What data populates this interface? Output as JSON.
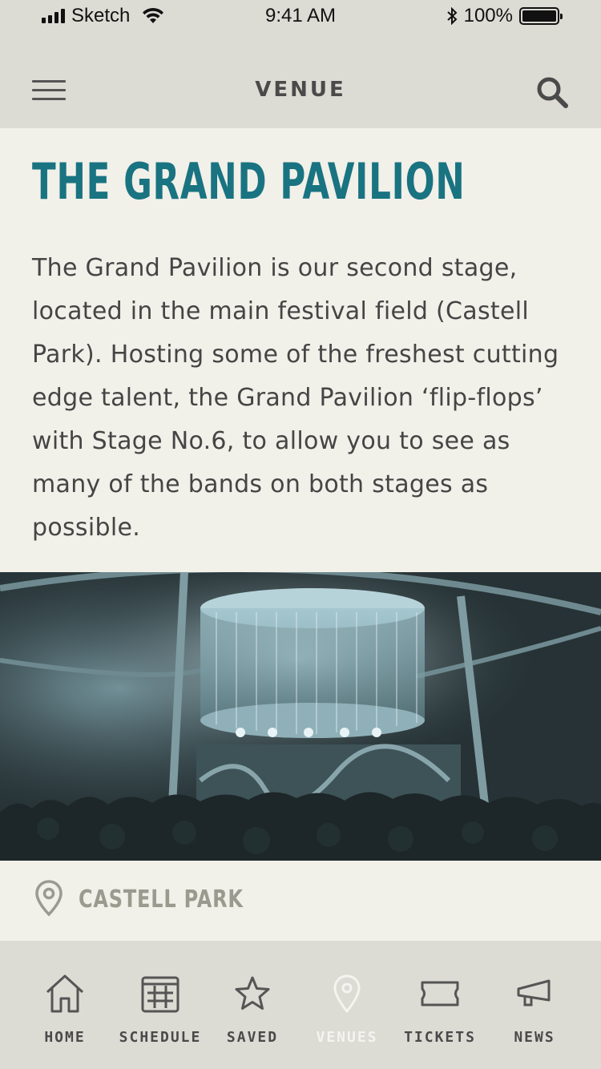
{
  "status_bar": {
    "carrier": "Sketch",
    "time": "9:41 AM",
    "battery": "100%"
  },
  "header": {
    "title": "VENUE",
    "menu_icon": "hamburger-menu-icon",
    "search_icon": "search-icon"
  },
  "venue": {
    "name": "THE GRAND PAVILION",
    "description": "The Grand Pavilion is our second stage, located in the main festival field (Castell Park). Hosting some of the freshest cutting edge talent, the Grand Pavilion ‘flip-flops’ with Stage No.6, to allow you to see as many of the bands on both stages as possible.",
    "location": "CASTELL PARK"
  },
  "tabs": [
    {
      "label": "HOME",
      "icon": "home-icon",
      "active": false
    },
    {
      "label": "SCHEDULE",
      "icon": "calendar-icon",
      "active": false
    },
    {
      "label": "SAVED",
      "icon": "star-icon",
      "active": false
    },
    {
      "label": "VENUES",
      "icon": "location-pin-icon",
      "active": true
    },
    {
      "label": "TICKETS",
      "icon": "ticket-icon",
      "active": false
    },
    {
      "label": "NEWS",
      "icon": "megaphone-icon",
      "active": false
    }
  ],
  "colors": {
    "accent": "#197381",
    "bar_background": "#dcdbd4",
    "page_background": "#f1f0e9",
    "image_tint": "#2f3d40"
  }
}
